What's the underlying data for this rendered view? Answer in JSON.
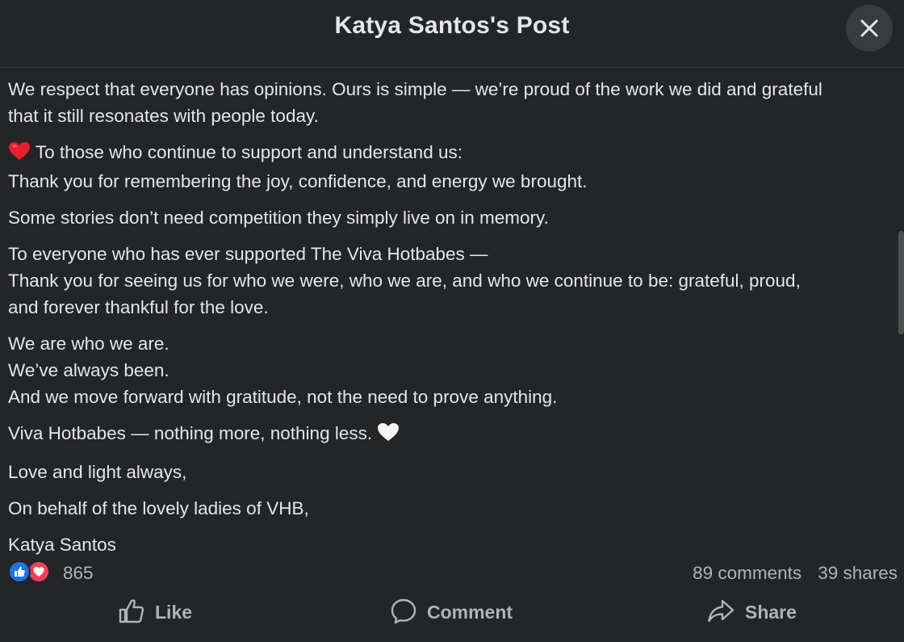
{
  "header": {
    "title": "Katya Santos's Post",
    "close_icon": "close-icon"
  },
  "post": {
    "p1": {
      "l1": "We respect that everyone has opinions. Ours is simple — we’re proud of the work we did and grateful",
      "l2": "that it still resonates with people today."
    },
    "p2": {
      "emoji": "red-heart-emoji",
      "l1": "To those who continue to support and understand us:",
      "l2": "Thank you for remembering the joy, confidence, and energy we brought."
    },
    "p3": {
      "l1": "Some stories don’t need competition they simply live on in memory."
    },
    "p4": {
      "l1": "To everyone who has ever supported The Viva Hotbabes —",
      "l2": "Thank you for seeing us for who we were, who we are, and who we continue to be: grateful, proud,",
      "l3": "and forever thankful for the love."
    },
    "p5": {
      "l1": "We are who we are.",
      "l2": "We’ve always been.",
      "l3": "And we move forward with gratitude, not the need to prove anything."
    },
    "p6": {
      "l1": "Viva Hotbabes — nothing more, nothing less.",
      "emoji": "white-heart-emoji"
    },
    "p7": {
      "l1": "Love and light always,"
    },
    "p8": {
      "l1": "On behalf of the lovely ladies of VHB,"
    },
    "p9": {
      "l1": "Katya Santos"
    }
  },
  "stats": {
    "reaction_icons": [
      "like-reaction-icon",
      "love-reaction-icon"
    ],
    "reaction_count": "865",
    "comments": "89 comments",
    "shares": "39 shares"
  },
  "actions": {
    "like": "Like",
    "comment": "Comment",
    "share": "Share"
  },
  "colors": {
    "background": "#242526",
    "text": "#e4e6eb",
    "secondary_text": "#b0b3b8",
    "like_blue": "#1b74e4",
    "love_red": "#f33e58"
  }
}
